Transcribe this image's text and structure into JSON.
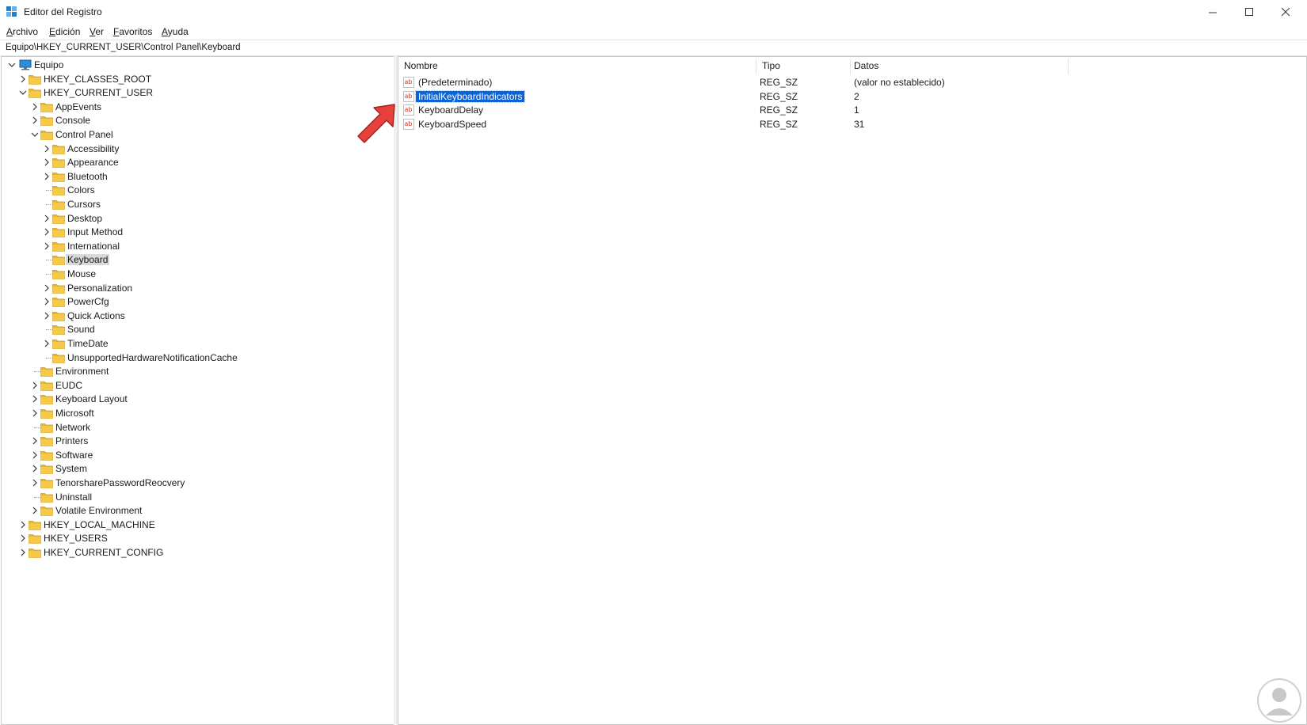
{
  "window": {
    "title": "Editor del Registro",
    "controls": [
      "minimize",
      "maximize",
      "close"
    ]
  },
  "menu": [
    {
      "label": "Archivo",
      "accel": "A",
      "rest": "rchivo"
    },
    {
      "label": "Edición",
      "accel": "E",
      "rest": "dición"
    },
    {
      "label": "Ver",
      "accel": "V",
      "rest": "er"
    },
    {
      "label": "Favoritos",
      "accel": "F",
      "rest": "avoritos"
    },
    {
      "label": "Ayuda",
      "accel": "A",
      "rest": "yuda"
    }
  ],
  "address": "Equipo\\HKEY_CURRENT_USER\\Control Panel\\Keyboard",
  "tree": {
    "root": "Equipo",
    "items": [
      {
        "label": "HKEY_CLASSES_ROOT",
        "level": 1,
        "expander": "collapsed"
      },
      {
        "label": "HKEY_CURRENT_USER",
        "level": 1,
        "expander": "expanded"
      },
      {
        "label": "AppEvents",
        "level": 2,
        "expander": "collapsed"
      },
      {
        "label": "Console",
        "level": 2,
        "expander": "collapsed"
      },
      {
        "label": "Control Panel",
        "level": 2,
        "expander": "expanded"
      },
      {
        "label": "Accessibility",
        "level": 3,
        "expander": "collapsed"
      },
      {
        "label": "Appearance",
        "level": 3,
        "expander": "collapsed"
      },
      {
        "label": "Bluetooth",
        "level": 3,
        "expander": "collapsed"
      },
      {
        "label": "Colors",
        "level": 3,
        "expander": "none"
      },
      {
        "label": "Cursors",
        "level": 3,
        "expander": "none"
      },
      {
        "label": "Desktop",
        "level": 3,
        "expander": "collapsed"
      },
      {
        "label": "Input Method",
        "level": 3,
        "expander": "collapsed"
      },
      {
        "label": "International",
        "level": 3,
        "expander": "collapsed"
      },
      {
        "label": "Keyboard",
        "level": 3,
        "expander": "none",
        "selected": true
      },
      {
        "label": "Mouse",
        "level": 3,
        "expander": "none"
      },
      {
        "label": "Personalization",
        "level": 3,
        "expander": "collapsed"
      },
      {
        "label": "PowerCfg",
        "level": 3,
        "expander": "collapsed"
      },
      {
        "label": "Quick Actions",
        "level": 3,
        "expander": "collapsed"
      },
      {
        "label": "Sound",
        "level": 3,
        "expander": "none"
      },
      {
        "label": "TimeDate",
        "level": 3,
        "expander": "collapsed"
      },
      {
        "label": "UnsupportedHardwareNotificationCache",
        "level": 3,
        "expander": "none"
      },
      {
        "label": "Environment",
        "level": 2,
        "expander": "none"
      },
      {
        "label": "EUDC",
        "level": 2,
        "expander": "collapsed"
      },
      {
        "label": "Keyboard Layout",
        "level": 2,
        "expander": "collapsed"
      },
      {
        "label": "Microsoft",
        "level": 2,
        "expander": "collapsed"
      },
      {
        "label": "Network",
        "level": 2,
        "expander": "none"
      },
      {
        "label": "Printers",
        "level": 2,
        "expander": "collapsed"
      },
      {
        "label": "Software",
        "level": 2,
        "expander": "collapsed"
      },
      {
        "label": "System",
        "level": 2,
        "expander": "collapsed"
      },
      {
        "label": "TenorsharePasswordReocvery",
        "level": 2,
        "expander": "collapsed"
      },
      {
        "label": "Uninstall",
        "level": 2,
        "expander": "none"
      },
      {
        "label": "Volatile Environment",
        "level": 2,
        "expander": "collapsed"
      },
      {
        "label": "HKEY_LOCAL_MACHINE",
        "level": 1,
        "expander": "collapsed"
      },
      {
        "label": "HKEY_USERS",
        "level": 1,
        "expander": "collapsed"
      },
      {
        "label": "HKEY_CURRENT_CONFIG",
        "level": 1,
        "expander": "collapsed"
      }
    ]
  },
  "values_list": {
    "columns": {
      "name": "Nombre",
      "type": "Tipo",
      "data": "Datos"
    },
    "rows": [
      {
        "name": "(Predeterminado)",
        "type": "REG_SZ",
        "data": "(valor no establecido)",
        "selected": false
      },
      {
        "name": "InitialKeyboardIndicators",
        "type": "REG_SZ",
        "data": "2",
        "selected": true
      },
      {
        "name": "KeyboardDelay",
        "type": "REG_SZ",
        "data": "1",
        "selected": false
      },
      {
        "name": "KeyboardSpeed",
        "type": "REG_SZ",
        "data": "31",
        "selected": false
      }
    ]
  },
  "icons": {
    "app": "registry-editor-icon",
    "folder": "folder-icon",
    "computer": "computer-icon",
    "string_value": "string-value-icon",
    "annotation": "red-arrow-icon",
    "watermark": "watermark-logo-icon"
  },
  "colors": {
    "selection_blue": "#0a64d8",
    "tree_selection": "#d9d9d9",
    "folder_yellow": "#f7c948",
    "arrow_red": "#e8403a"
  }
}
